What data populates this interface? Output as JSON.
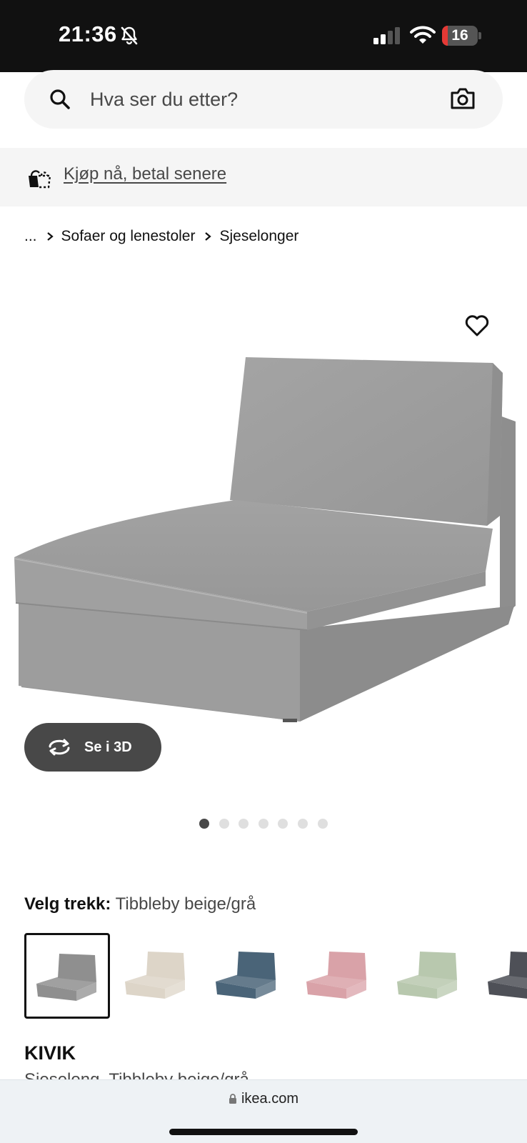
{
  "status_bar": {
    "time": "21:36",
    "battery_level": "16",
    "battery_fraction": 0.16
  },
  "search": {
    "placeholder": "Hva ser du etter?"
  },
  "banner": {
    "pay_later_label": "Kjøp nå, betal senere"
  },
  "breadcrumb": {
    "ellipsis": "...",
    "items": [
      "Sofaer og lenestoler",
      "Sjeselonger"
    ]
  },
  "gallery": {
    "see_3d_label": "Se i 3D",
    "dot_count": 7,
    "active_dot": 0
  },
  "cover": {
    "label": "Velg trekk:",
    "value": "Tibbleby beige/grå",
    "swatch_colors": [
      "#8f8f8f",
      "#ddd5c8",
      "#4a6478",
      "#d9a2a8",
      "#b8c8ae",
      "#4e5057"
    ],
    "selected_index": 0
  },
  "product": {
    "name": "KIVIK",
    "description": "Sjeselong, Tibbleby beige/grå"
  },
  "browser": {
    "url": "ikea.com"
  },
  "colors": {
    "status_bar_bg": "#111111",
    "battery_low": "#e53935",
    "button_dark": "#484848"
  }
}
